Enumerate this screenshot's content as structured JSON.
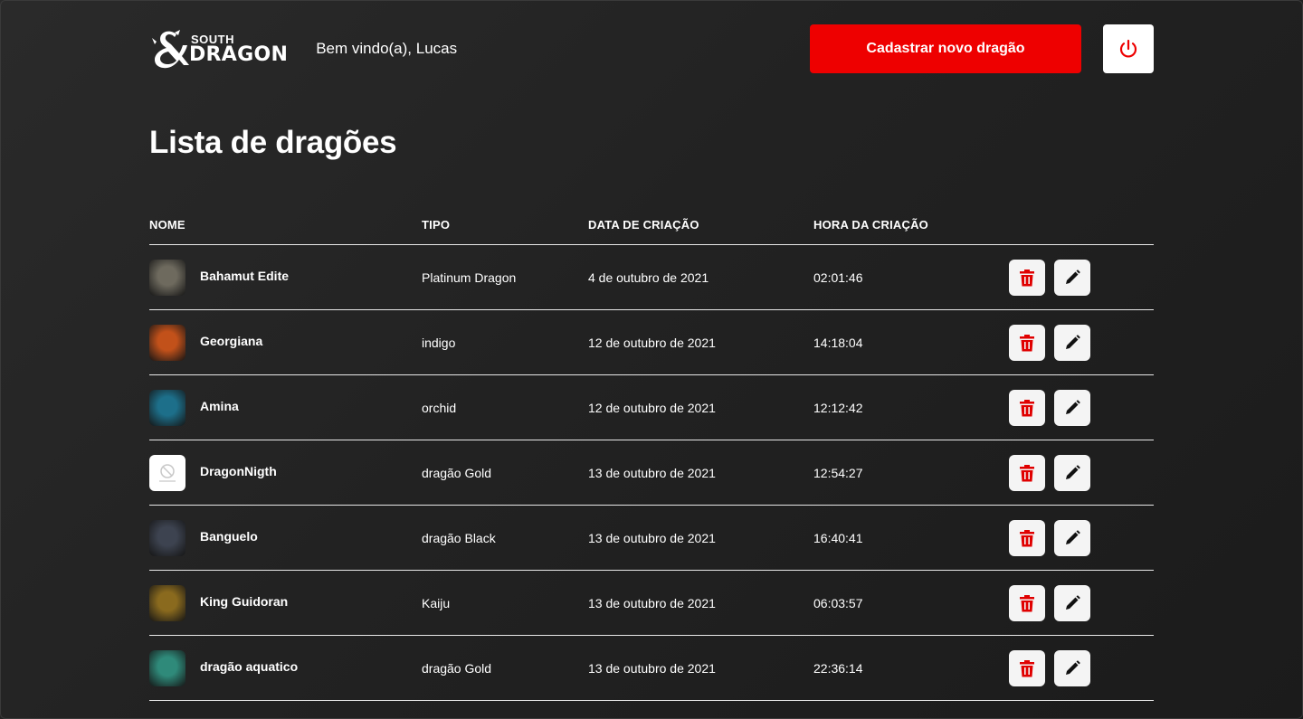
{
  "header": {
    "logo_top": "SOUTH",
    "logo_bottom": "DRAGON",
    "welcome": "Bem vindo(a), Lucas",
    "new_button": "Cadastrar novo dragão",
    "logout_icon": "power-icon",
    "accent_color": "#ee0000"
  },
  "page": {
    "title": "Lista de dragões"
  },
  "table": {
    "columns": [
      "NOME",
      "TIPO",
      "DATA DE CRIAÇÃO",
      "HORA DA CRIAÇÃO"
    ],
    "action_icons": [
      "trash-icon",
      "pencil-icon"
    ],
    "rows": [
      {
        "name": "Bahamut Edite",
        "type": "Platinum Dragon",
        "date": "4 de outubro de 2021",
        "time": "02:01:46",
        "thumb_color": "#6e6a5e"
      },
      {
        "name": "Georgiana",
        "type": "indigo",
        "date": "12 de outubro de 2021",
        "time": "14:18:04",
        "thumb_color": "#c2511a"
      },
      {
        "name": "Amina",
        "type": "orchid",
        "date": "12 de outubro de 2021",
        "time": "12:12:42",
        "thumb_color": "#1d6f8a"
      },
      {
        "name": "DragonNigth",
        "type": "dragão Gold",
        "date": "13 de outubro de 2021",
        "time": "12:54:27",
        "thumb_color": "#ffffff"
      },
      {
        "name": "Banguelo",
        "type": "dragão Black",
        "date": "13 de outubro de 2021",
        "time": "16:40:41",
        "thumb_color": "#3d4350"
      },
      {
        "name": "King Guidoran",
        "type": "Kaiju",
        "date": "13 de outubro de 2021",
        "time": "06:03:57",
        "thumb_color": "#8a6a1e"
      },
      {
        "name": "dragão aquatico",
        "type": "dragão Gold",
        "date": "13 de outubro de 2021",
        "time": "22:36:14",
        "thumb_color": "#2f8a7a"
      }
    ]
  }
}
